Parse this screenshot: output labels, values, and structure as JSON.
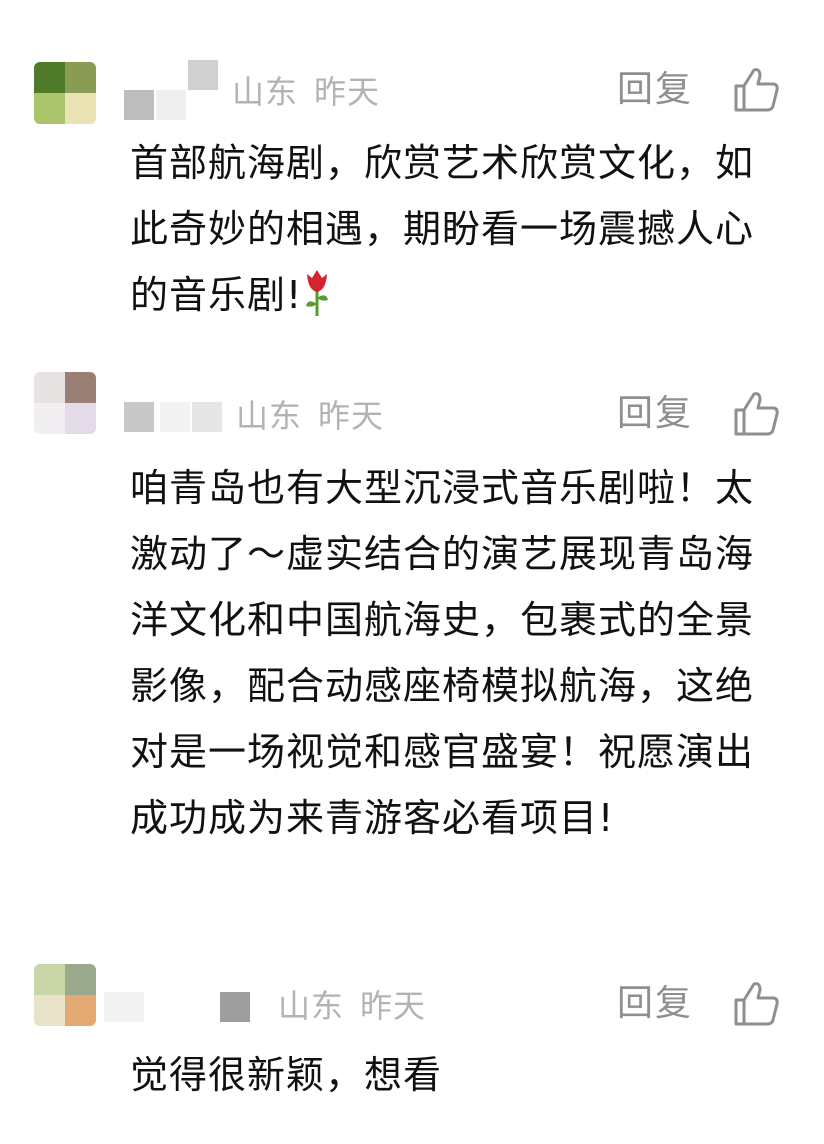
{
  "comments": [
    {
      "location": "山东",
      "time": "昨天",
      "reply_label": "回复",
      "text": "首部航海剧，欣赏艺术欣赏文化，如此奇妙的相遇，期盼看一场震撼人心的音乐剧!",
      "emoji": "rose-icon"
    },
    {
      "location": "山东",
      "time": "昨天",
      "reply_label": "回复",
      "text": "咱青岛也有大型沉浸式音乐剧啦！太激动了～虚实结合的演艺展现青岛海洋文化和中国航海史，包裹式的全景影像，配合动感座椅模拟航海，这绝对是一场视觉和感官盛宴！祝愿演出成功成为来青游客必看项目!"
    },
    {
      "location": "山东",
      "time": "昨天",
      "reply_label": "回复",
      "text": "觉得很新颖，想看"
    }
  ],
  "colors": {
    "meta_gray": "#b3b3b3",
    "reply_gray": "#8f8f8f",
    "text_black": "#111111",
    "rose_red": "#d4252e",
    "leaf_green": "#5a9a2c"
  }
}
